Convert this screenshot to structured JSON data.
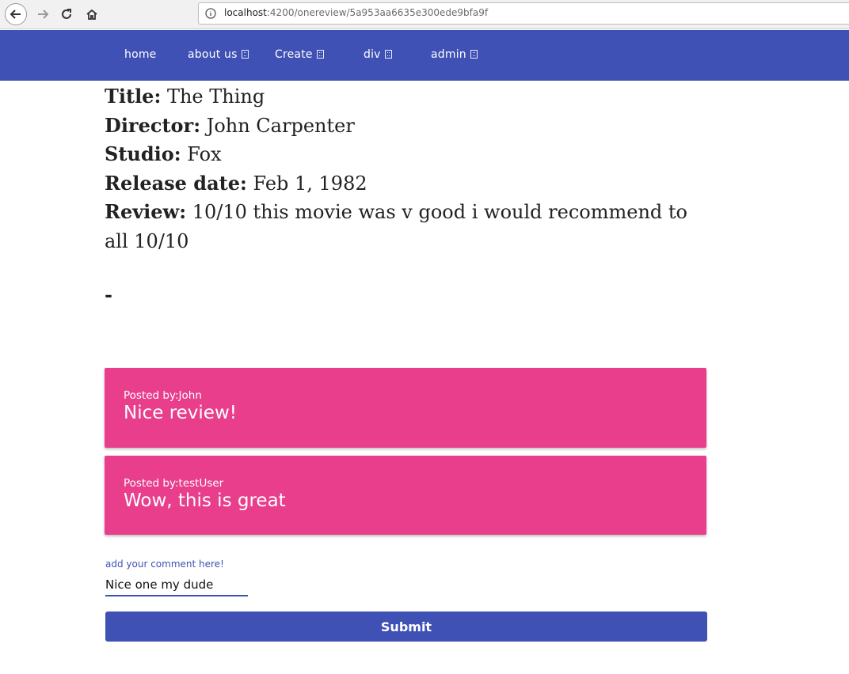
{
  "browser": {
    "url_host": "localhost",
    "url_path": ":4200/onereview/5a953aa6635e300ede9bfa9f"
  },
  "nav": {
    "items": [
      {
        "label": "home"
      },
      {
        "label": "about us"
      },
      {
        "label": "Create"
      },
      {
        "label": "div"
      },
      {
        "label": "admin"
      }
    ]
  },
  "review": {
    "title_label": "Title:",
    "title_value": " The Thing",
    "director_label": "Director:",
    "director_value": " John Carpenter",
    "studio_label": "Studio:",
    "studio_value": " Fox",
    "release_label": "Release date:",
    "release_value": " Feb 1, 1982",
    "review_label": "Review:",
    "review_value": " 10/10 this movie was v good i would recommend to all 10/10",
    "separator": "-"
  },
  "comments": [
    {
      "posted_by": "Posted by:John",
      "text": "Nice review!"
    },
    {
      "posted_by": "Posted by:testUser",
      "text": "Wow, this is great"
    }
  ],
  "form": {
    "label": "add your comment here!",
    "value": "Nice one my dude",
    "submit_label": "Submit"
  },
  "colors": {
    "primary": "#3f51b5",
    "accent": "#e83e8c"
  }
}
